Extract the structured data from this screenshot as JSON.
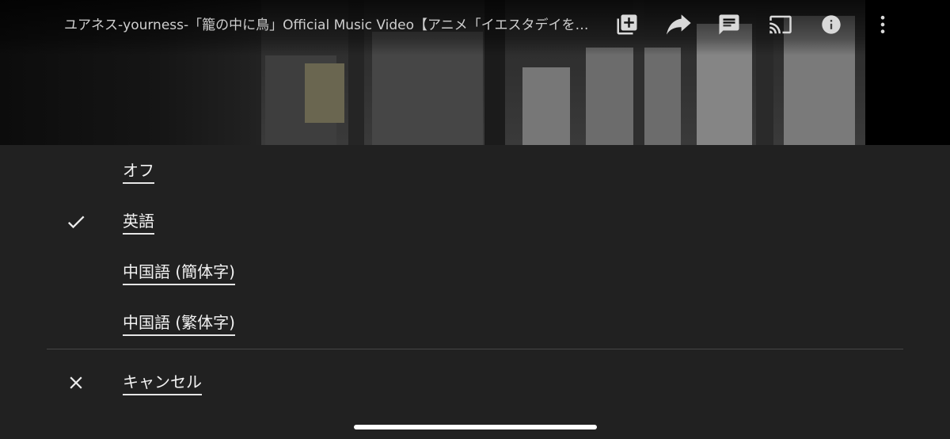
{
  "video": {
    "title": "ユアネス-yourness-「籠の中に鳥」Official Music Video【アニメ「イエスタデイをうたって」OP】"
  },
  "controls": [
    {
      "name": "add-to-playlist-icon"
    },
    {
      "name": "share-icon"
    },
    {
      "name": "captions-icon"
    },
    {
      "name": "cast-icon"
    },
    {
      "name": "info-icon"
    },
    {
      "name": "more-options-icon"
    }
  ],
  "caption_menu": {
    "options": [
      {
        "label": "オフ",
        "selected": false
      },
      {
        "label": "英語",
        "selected": true
      },
      {
        "label": "中国語 (簡体字)",
        "selected": false
      },
      {
        "label": "中国語 (繁体字)",
        "selected": false
      }
    ],
    "cancel_label": "キャンセル",
    "selected_icon": "checkmark-icon",
    "cancel_icon": "close-icon"
  },
  "colors": {
    "sheet_background": "#212121",
    "text": "#f2f2f2",
    "icon": "#d9d9d9"
  }
}
